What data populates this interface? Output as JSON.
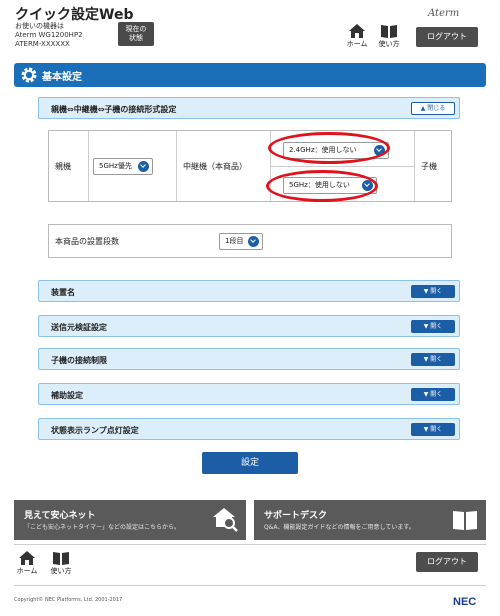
{
  "header": {
    "title": "クイック設定Web",
    "device_line1": "お使いの機器は",
    "device_line2": "Aterm WG1200HP2",
    "device_line3": "ATERM-XXXXXX",
    "status_btn_line1": "現在の",
    "status_btn_line2": "状態",
    "brand": "Aterm",
    "home_label": "ホーム",
    "manual_label": "使い方",
    "logout_label": "ログアウト"
  },
  "section": {
    "title": "基本設定"
  },
  "connection": {
    "title": "親機⇔中継機⇔子機の接続形式設定",
    "close_label": "閉じる",
    "parent_label": "親機",
    "parent_select": "5GHz優先",
    "relay_label": "中継機（本商品）",
    "relay_24": "2.4GHz：使用しない",
    "relay_5": "5GHz：使用しない",
    "child_label": "子機"
  },
  "stage": {
    "label": "本商品の設置段数",
    "value": "1段目"
  },
  "accordions": [
    {
      "title": "装置名",
      "button": "開く"
    },
    {
      "title": "送信元検証設定",
      "button": "開く"
    },
    {
      "title": "子機の接続制限",
      "button": "開く"
    },
    {
      "title": "補助設定",
      "button": "開く"
    },
    {
      "title": "状態表示ランプ点灯設定",
      "button": "開く"
    }
  ],
  "set_button": "設定",
  "banners": {
    "left_title": "見えて安心ネット",
    "left_desc": "「こども安心ネットタイマー」などの設定はこちらから。",
    "right_title": "サポートデスク",
    "right_desc": "Q&A、機能設定ガイドなどの情報をご用意しています。"
  },
  "footer": {
    "home_label": "ホーム",
    "manual_label": "使い方",
    "logout_label": "ログアウト",
    "copyright": "Copyright© NEC Platforms, Ltd. 2001-2017",
    "logo": "NEC"
  },
  "colors": {
    "accent": "#1b5ea6",
    "section": "#1a6fb8",
    "highlight_ring": "#e0121b"
  }
}
